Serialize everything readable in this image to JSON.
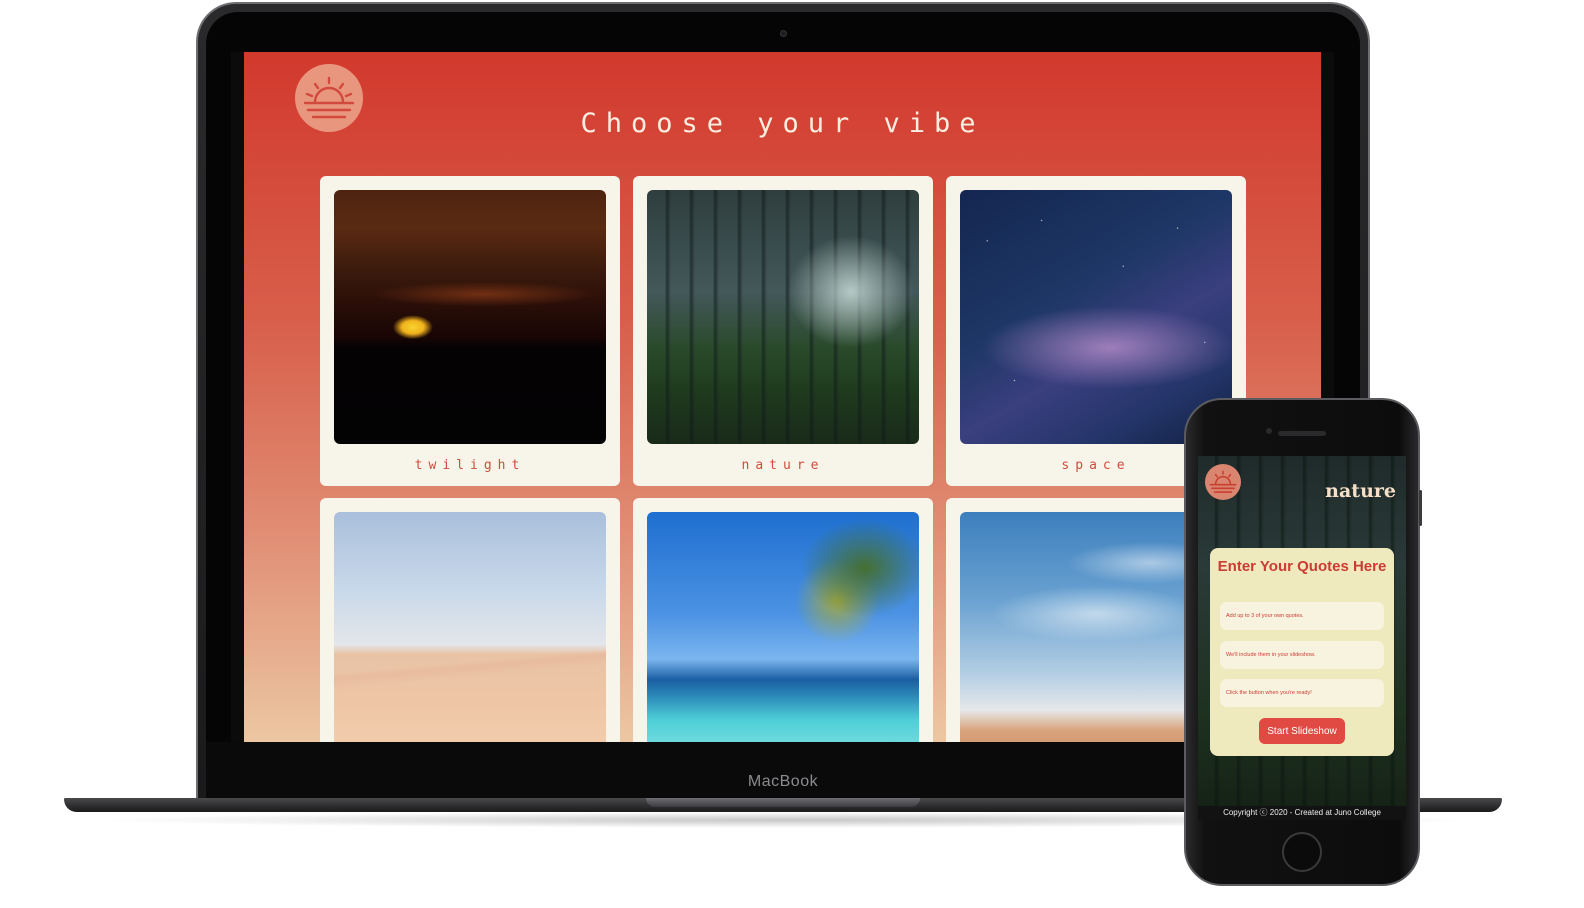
{
  "device_labels": {
    "laptop": "MacBook"
  },
  "desktop": {
    "page_title": "Choose your vibe",
    "logo_icon": "sunset-logo-icon",
    "vibes": [
      {
        "label": "twilight"
      },
      {
        "label": "nature"
      },
      {
        "label": "space"
      },
      {
        "label": ""
      },
      {
        "label": ""
      },
      {
        "label": ""
      }
    ]
  },
  "mobile": {
    "title": "nature",
    "logo_icon": "sunset-logo-icon",
    "panel_heading": "Enter Your Quotes Here",
    "inputs": [
      {
        "placeholder": "Add up to 3 of your own quotes."
      },
      {
        "placeholder": "We'll include them in your slideshow."
      },
      {
        "placeholder": "Click the button when you're ready!"
      }
    ],
    "start_button": "Start Slideshow",
    "footer": "Copyright ⓒ 2020 - Created at Juno College"
  },
  "colors": {
    "accent_red": "#d24a3d",
    "card_bg": "#f7f5ea",
    "panel_bg": "#eeeabd",
    "button_red": "#e04a42"
  }
}
